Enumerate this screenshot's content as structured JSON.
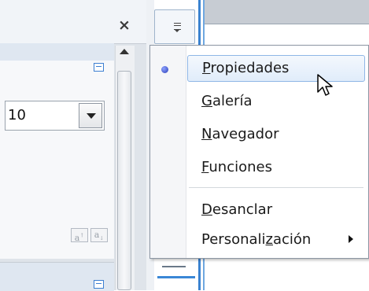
{
  "sidebar_panel": {
    "close_label": "×",
    "font_size_value": "10"
  },
  "context_menu": {
    "items": [
      {
        "prefix": "",
        "mnemonic": "P",
        "rest": "ropiedades",
        "checked": true
      },
      {
        "prefix": "",
        "mnemonic": "G",
        "rest": "alería",
        "checked": false
      },
      {
        "prefix": "",
        "mnemonic": "N",
        "rest": "avegador",
        "checked": false
      },
      {
        "prefix": "",
        "mnemonic": "F",
        "rest": "unciones",
        "checked": false
      },
      {
        "prefix": "",
        "mnemonic": "D",
        "rest": "esanclar",
        "checked": false
      },
      {
        "prefix": "Personali",
        "mnemonic": "z",
        "rest": "ación",
        "checked": false,
        "has_submenu": true
      }
    ]
  },
  "icons": {
    "close": "close-icon",
    "more_options": "more-options-icon",
    "dropdown": "chevron-down-icon",
    "grow_font": "grow-font-icon",
    "shrink_font": "shrink-font-icon",
    "sidebar_menu": "menu-lines-icon",
    "radio": "radio-bullet-icon",
    "submenu": "submenu-arrow-icon",
    "cursor": "mouse-pointer-icon"
  },
  "colors": {
    "highlight_border": "#8fb6e6",
    "highlight_fill": "#e0ecfa",
    "accent_blue": "#3a82d0"
  }
}
